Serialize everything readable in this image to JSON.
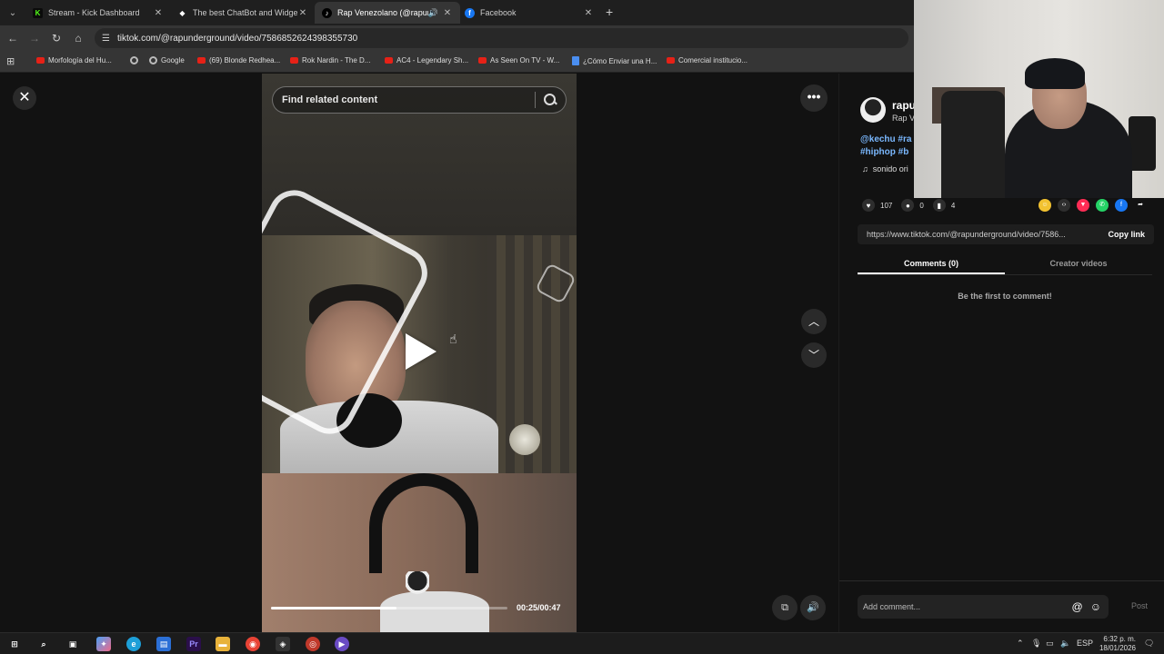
{
  "tabs": [
    {
      "title": "Stream - Kick Dashboard",
      "favicon": "K",
      "favicon_color": "#53fc18"
    },
    {
      "title": "The best ChatBot and Widgets",
      "favicon": "◆",
      "favicon_color": "#ffffff"
    },
    {
      "title": "Rap Venezolano (@rapund",
      "favicon": "♪",
      "favicon_color": "#ffffff"
    },
    {
      "title": "Facebook",
      "favicon": "f",
      "favicon_color": "#1877f2"
    }
  ],
  "address": {
    "url": "tiktok.com/@rapunderground/video/7586852624398355730"
  },
  "bookmarks": [
    {
      "label": "Morfología del Hu...",
      "type": "youtube"
    },
    {
      "label": "",
      "type": "globe"
    },
    {
      "label": "Google",
      "type": "google"
    },
    {
      "label": "(69) Blonde Redhea...",
      "type": "youtube"
    },
    {
      "label": "Rok Nardin - The D...",
      "type": "youtube"
    },
    {
      "label": "AC4 - Legendary Sh...",
      "type": "youtube"
    },
    {
      "label": "As Seen On TV - W...",
      "type": "youtube"
    },
    {
      "label": "¿Cómo Enviar una H...",
      "type": "doc"
    },
    {
      "label": "Comercial institucio...",
      "type": "youtube"
    }
  ],
  "player": {
    "search_placeholder": "Find related content",
    "time": "00:25/00:47",
    "progress_fraction": 0.53
  },
  "author": {
    "username": "rapu",
    "nickname": "Rap V",
    "description_line1": "@kechu #ra",
    "description_line2": "#hiphop #b",
    "sound": "sonido ori"
  },
  "stats": {
    "likes": "107",
    "comments": "0",
    "saves": "4"
  },
  "share": {
    "link": "https://www.tiktok.com/@rapunderground/video/7586...",
    "copy_label": "Copy link"
  },
  "comment_tabs": {
    "comments": "Comments (0)",
    "creator_videos": "Creator videos"
  },
  "empty_comments": "Be the first to comment!",
  "comment_input": {
    "placeholder": "Add comment...",
    "post_label": "Post"
  },
  "taskbar": {
    "language": "ESP",
    "time": "6:32 p. m.",
    "date": "18/01/2026"
  },
  "colors": {
    "accent_link": "#7ab8ff",
    "youtube_red": "#e62117"
  }
}
